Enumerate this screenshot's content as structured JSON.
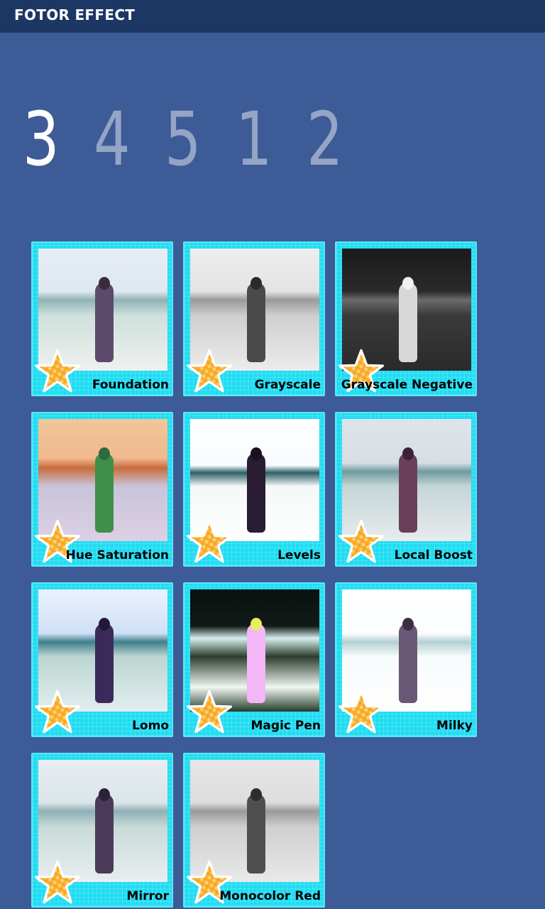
{
  "app": {
    "title": "FOTOR EFFECT"
  },
  "pivot": {
    "items": [
      "3",
      "4",
      "5",
      "1",
      "2"
    ],
    "selected": "3"
  },
  "effects": [
    {
      "label": "Foundation",
      "style": "foundation"
    },
    {
      "label": "Grayscale",
      "style": "grayscale"
    },
    {
      "label": "Grayscale Negative",
      "style": "negative"
    },
    {
      "label": "Hue Saturation",
      "style": "hue"
    },
    {
      "label": "Levels",
      "style": "levels"
    },
    {
      "label": "Local Boost",
      "style": "localboost"
    },
    {
      "label": "Lomo",
      "style": "lomo"
    },
    {
      "label": "Magic Pen",
      "style": "magicpen"
    },
    {
      "label": "Milky",
      "style": "milky"
    },
    {
      "label": "Mirror",
      "style": "mirror"
    },
    {
      "label": "Monocolor Red",
      "style": "monored"
    }
  ],
  "colors": {
    "background": "#3d5b96",
    "titlebar": "#1d3764",
    "tile": "#1fdcf2",
    "star": "#f5a623"
  },
  "icons": {
    "tile_badge": "star-icon"
  }
}
